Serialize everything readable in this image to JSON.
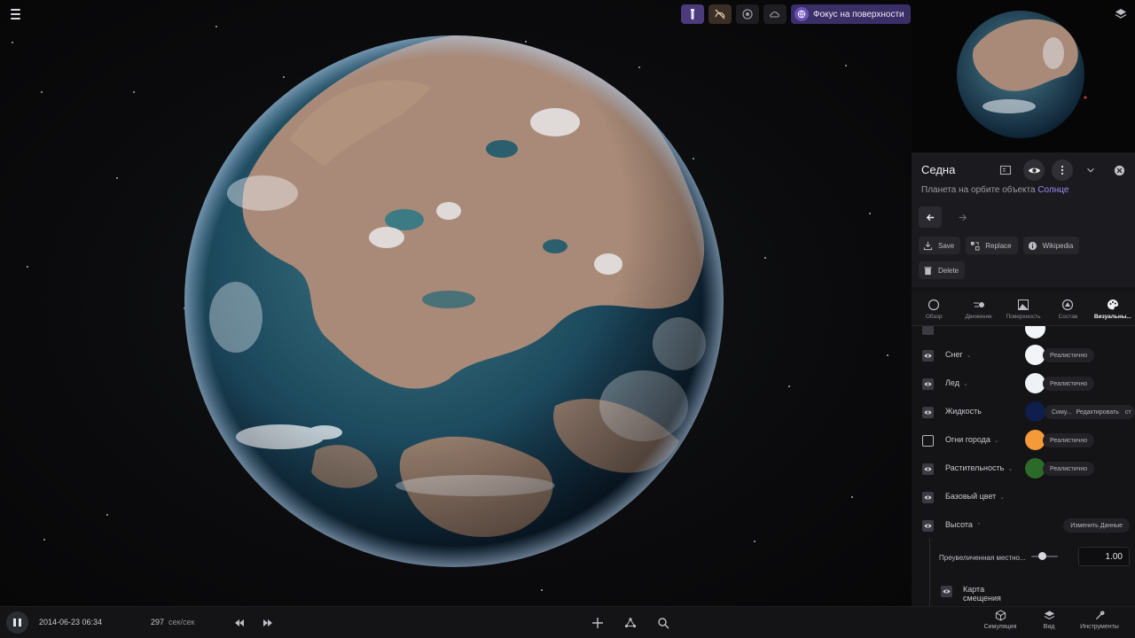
{
  "top_toolbar": {
    "focus_label": "Фокус на поверхности"
  },
  "panel": {
    "object_name": "Седна",
    "subtitle_prefix": "Планета на орбите объекта",
    "subtitle_link": "Солнце",
    "actions": {
      "save": "Save",
      "replace": "Replace",
      "wikipedia": "Wikipedia",
      "delete": "Delete"
    },
    "tabs": [
      {
        "label": "Обзор",
        "icon": "circle-icon"
      },
      {
        "label": "Движение",
        "icon": "motion-icon"
      },
      {
        "label": "Поверхность",
        "icon": "surface-icon"
      },
      {
        "label": "Состав",
        "icon": "composition-icon"
      },
      {
        "label": "Визуальны...",
        "icon": "palette-icon",
        "active": true
      }
    ],
    "properties": [
      {
        "label": "Снег",
        "color": "#f2f4f7",
        "mode": "Реалистично",
        "checked": true
      },
      {
        "label": "Лед",
        "color": "#eef1f5",
        "mode": "Реалистично",
        "checked": true
      },
      {
        "label": "Жидкость",
        "color": "#0f1e4a",
        "mode": "Симу...",
        "edit": "Редактировать",
        "extra": "ст",
        "checked": true
      },
      {
        "label": "Огни города",
        "color": "#f59a38",
        "mode": "Реалистично",
        "checked": false
      },
      {
        "label": "Растительность",
        "color": "#2c6a2a",
        "mode": "Реалистично",
        "checked": true
      },
      {
        "label": "Базовый цвет",
        "checked": true
      },
      {
        "label": "Высота",
        "button": "Изменить Данные",
        "checked": true
      }
    ],
    "exaggeration_label": "Преувеличенная местно...",
    "exaggeration_value": "1.00",
    "displacement_label": "Карта смещения"
  },
  "bottom_bar": {
    "date": "2014-06-23 06:34",
    "speed_value": "297",
    "speed_unit": "сек/сек",
    "tools": [
      {
        "label": "Симуляция",
        "icon": "cube-icon"
      },
      {
        "label": "Вид",
        "icon": "layers-icon"
      },
      {
        "label": "Инструменты",
        "icon": "wrench-icon"
      }
    ]
  }
}
